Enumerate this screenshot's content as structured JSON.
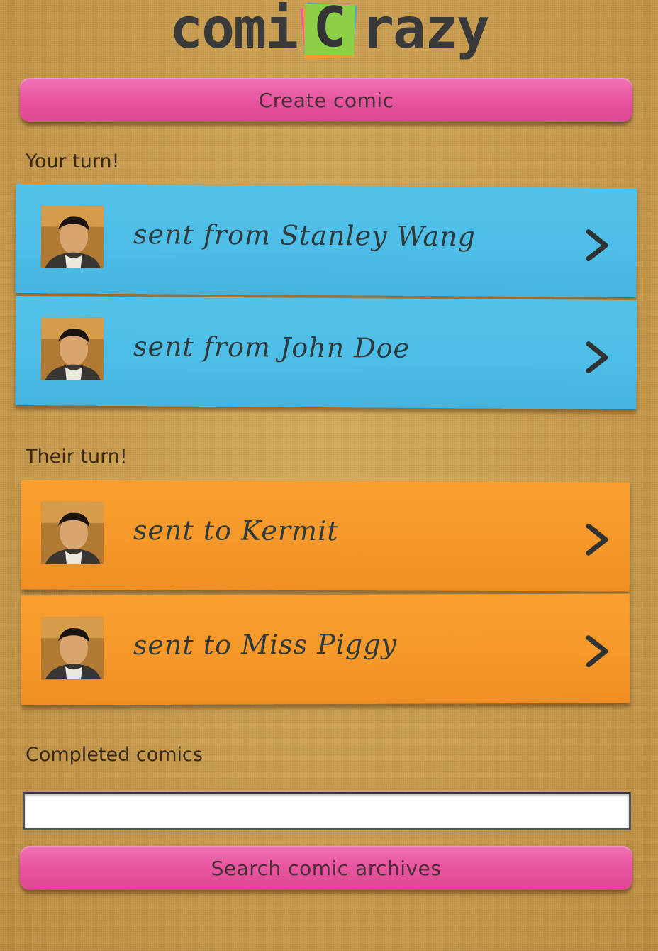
{
  "logo": {
    "left_text": "comi",
    "center_letter": "C",
    "right_text": "razy"
  },
  "buttons": {
    "create_label": "Create comic",
    "search_label": "Search comic archives"
  },
  "sections": {
    "your_turn": "Your turn!",
    "their_turn": "Their turn!",
    "completed": "Completed comics"
  },
  "your_turn_items": [
    {
      "label": "sent from Stanley Wang",
      "avatar": "user-avatar"
    },
    {
      "label": "sent from John Doe",
      "avatar": "user-avatar"
    }
  ],
  "their_turn_items": [
    {
      "label": "sent to Kermit",
      "avatar": "user-avatar"
    },
    {
      "label": "sent to Miss Piggy",
      "avatar": "user-avatar"
    }
  ],
  "search": {
    "value": "",
    "placeholder": ""
  },
  "colors": {
    "pink_button": "#e8559f",
    "your_turn_note": "#4dbde7",
    "their_turn_note": "#f69729",
    "background": "#c99e52"
  },
  "icons": {
    "chevron": "chevron-right-icon",
    "logo_note": "sticky-note-icon"
  }
}
